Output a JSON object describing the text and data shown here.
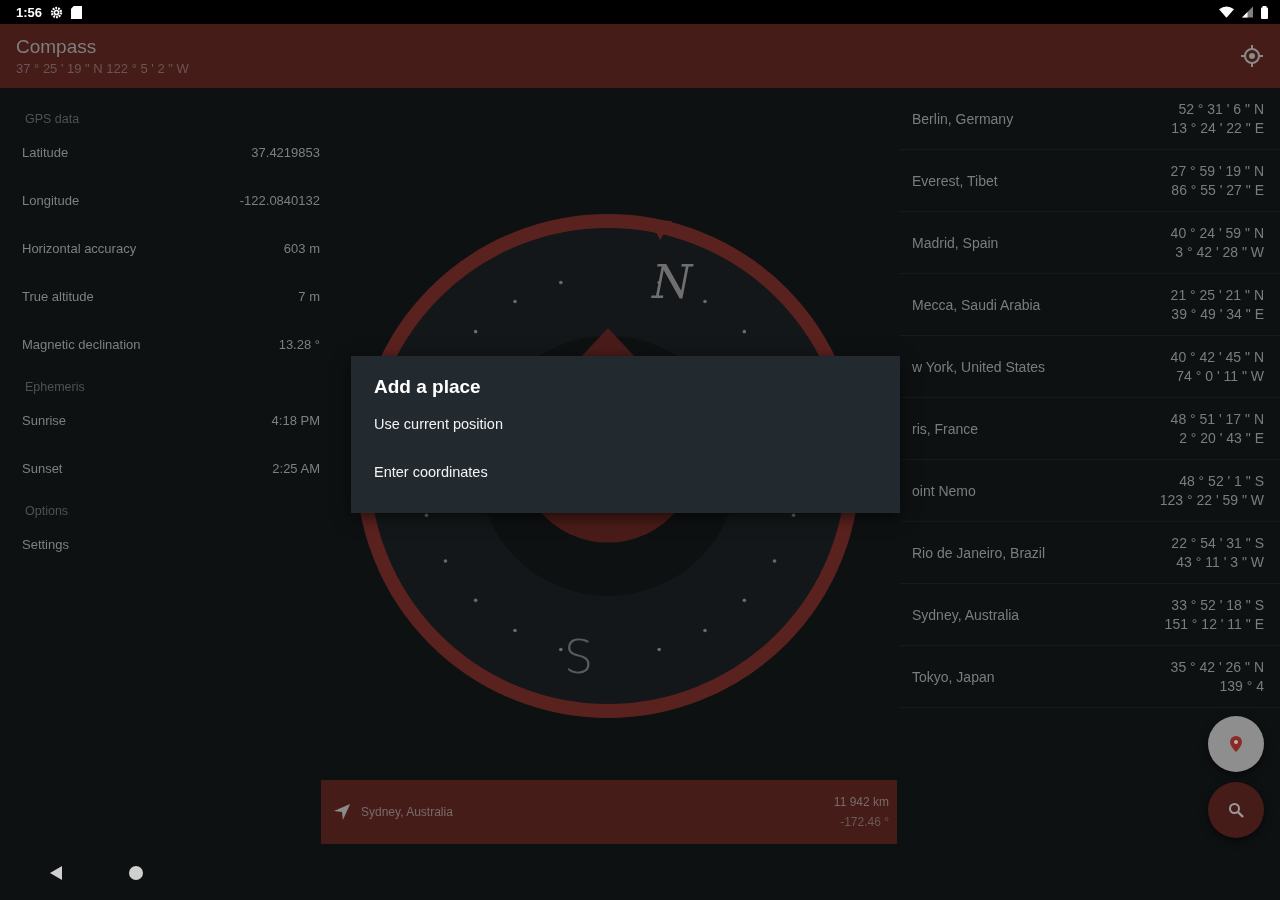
{
  "status_bar": {
    "time": "1:56"
  },
  "toolbar": {
    "title": "Compass",
    "subtitle": "37 ° 25 ' 19 \" N 122 ° 5 ' 2 \" W"
  },
  "sections": [
    {
      "title": "GPS data",
      "rows": [
        {
          "label": "Latitude",
          "value": "37.4219853"
        },
        {
          "label": "Longitude",
          "value": "-122.0840132"
        },
        {
          "label": "Horizontal accuracy",
          "value": "603 m"
        },
        {
          "label": "True altitude",
          "value": "7 m"
        },
        {
          "label": "Magnetic declination",
          "value": "13.28 °"
        }
      ]
    },
    {
      "title": "Ephemeris",
      "rows": [
        {
          "label": "Sunrise",
          "value": "4:18 PM"
        },
        {
          "label": "Sunset",
          "value": "2:25 AM"
        }
      ]
    },
    {
      "title": "Options",
      "rows": [
        {
          "label": "Settings"
        }
      ]
    }
  ],
  "compass": {
    "north": "N",
    "south": "S"
  },
  "places": [
    {
      "name": "Berlin, Germany",
      "lat": "52 ° 31 ' 6 \" N",
      "lon": "13 ° 24 ' 22 \" E"
    },
    {
      "name": "Everest, Tibet",
      "lat": "27 ° 59 ' 19 \" N",
      "lon": "86 ° 55 ' 27 \" E"
    },
    {
      "name": "Madrid, Spain",
      "lat": "40 ° 24 ' 59 \" N",
      "lon": "3 ° 42 ' 28 \" W"
    },
    {
      "name": "Mecca, Saudi Arabia",
      "lat": "21 ° 25 ' 21 \" N",
      "lon": "39 ° 49 ' 34 \" E"
    },
    {
      "name": "w York, United States",
      "lat": "40 ° 42 ' 45 \" N",
      "lon": "74 ° 0 ' 11 \" W"
    },
    {
      "name": "ris, France",
      "lat": "48 ° 51 ' 17 \" N",
      "lon": "2 ° 20 ' 43 \" E"
    },
    {
      "name": "oint Nemo",
      "lat": "48 ° 52 ' 1 \" S",
      "lon": "123 ° 22 ' 59 \" W"
    },
    {
      "name": "Rio de Janeiro, Brazil",
      "lat": "22 ° 54 ' 31 \" S",
      "lon": "43 ° 11 ' 3 \" W"
    },
    {
      "name": "Sydney, Australia",
      "lat": "33 ° 52 ' 18 \" S",
      "lon": "151 ° 12 ' 11 \" E"
    },
    {
      "name": "Tokyo, Japan",
      "lat": "35 ° 42 ' 26 \" N",
      "lon": "139 ° 4"
    }
  ],
  "destination": {
    "name": "Sydney, Australia",
    "distance": "11 942 km",
    "bearing": "-172.46 °"
  },
  "dialog": {
    "title": "Add a place",
    "options": [
      "Use current position",
      "Enter coordinates"
    ]
  }
}
